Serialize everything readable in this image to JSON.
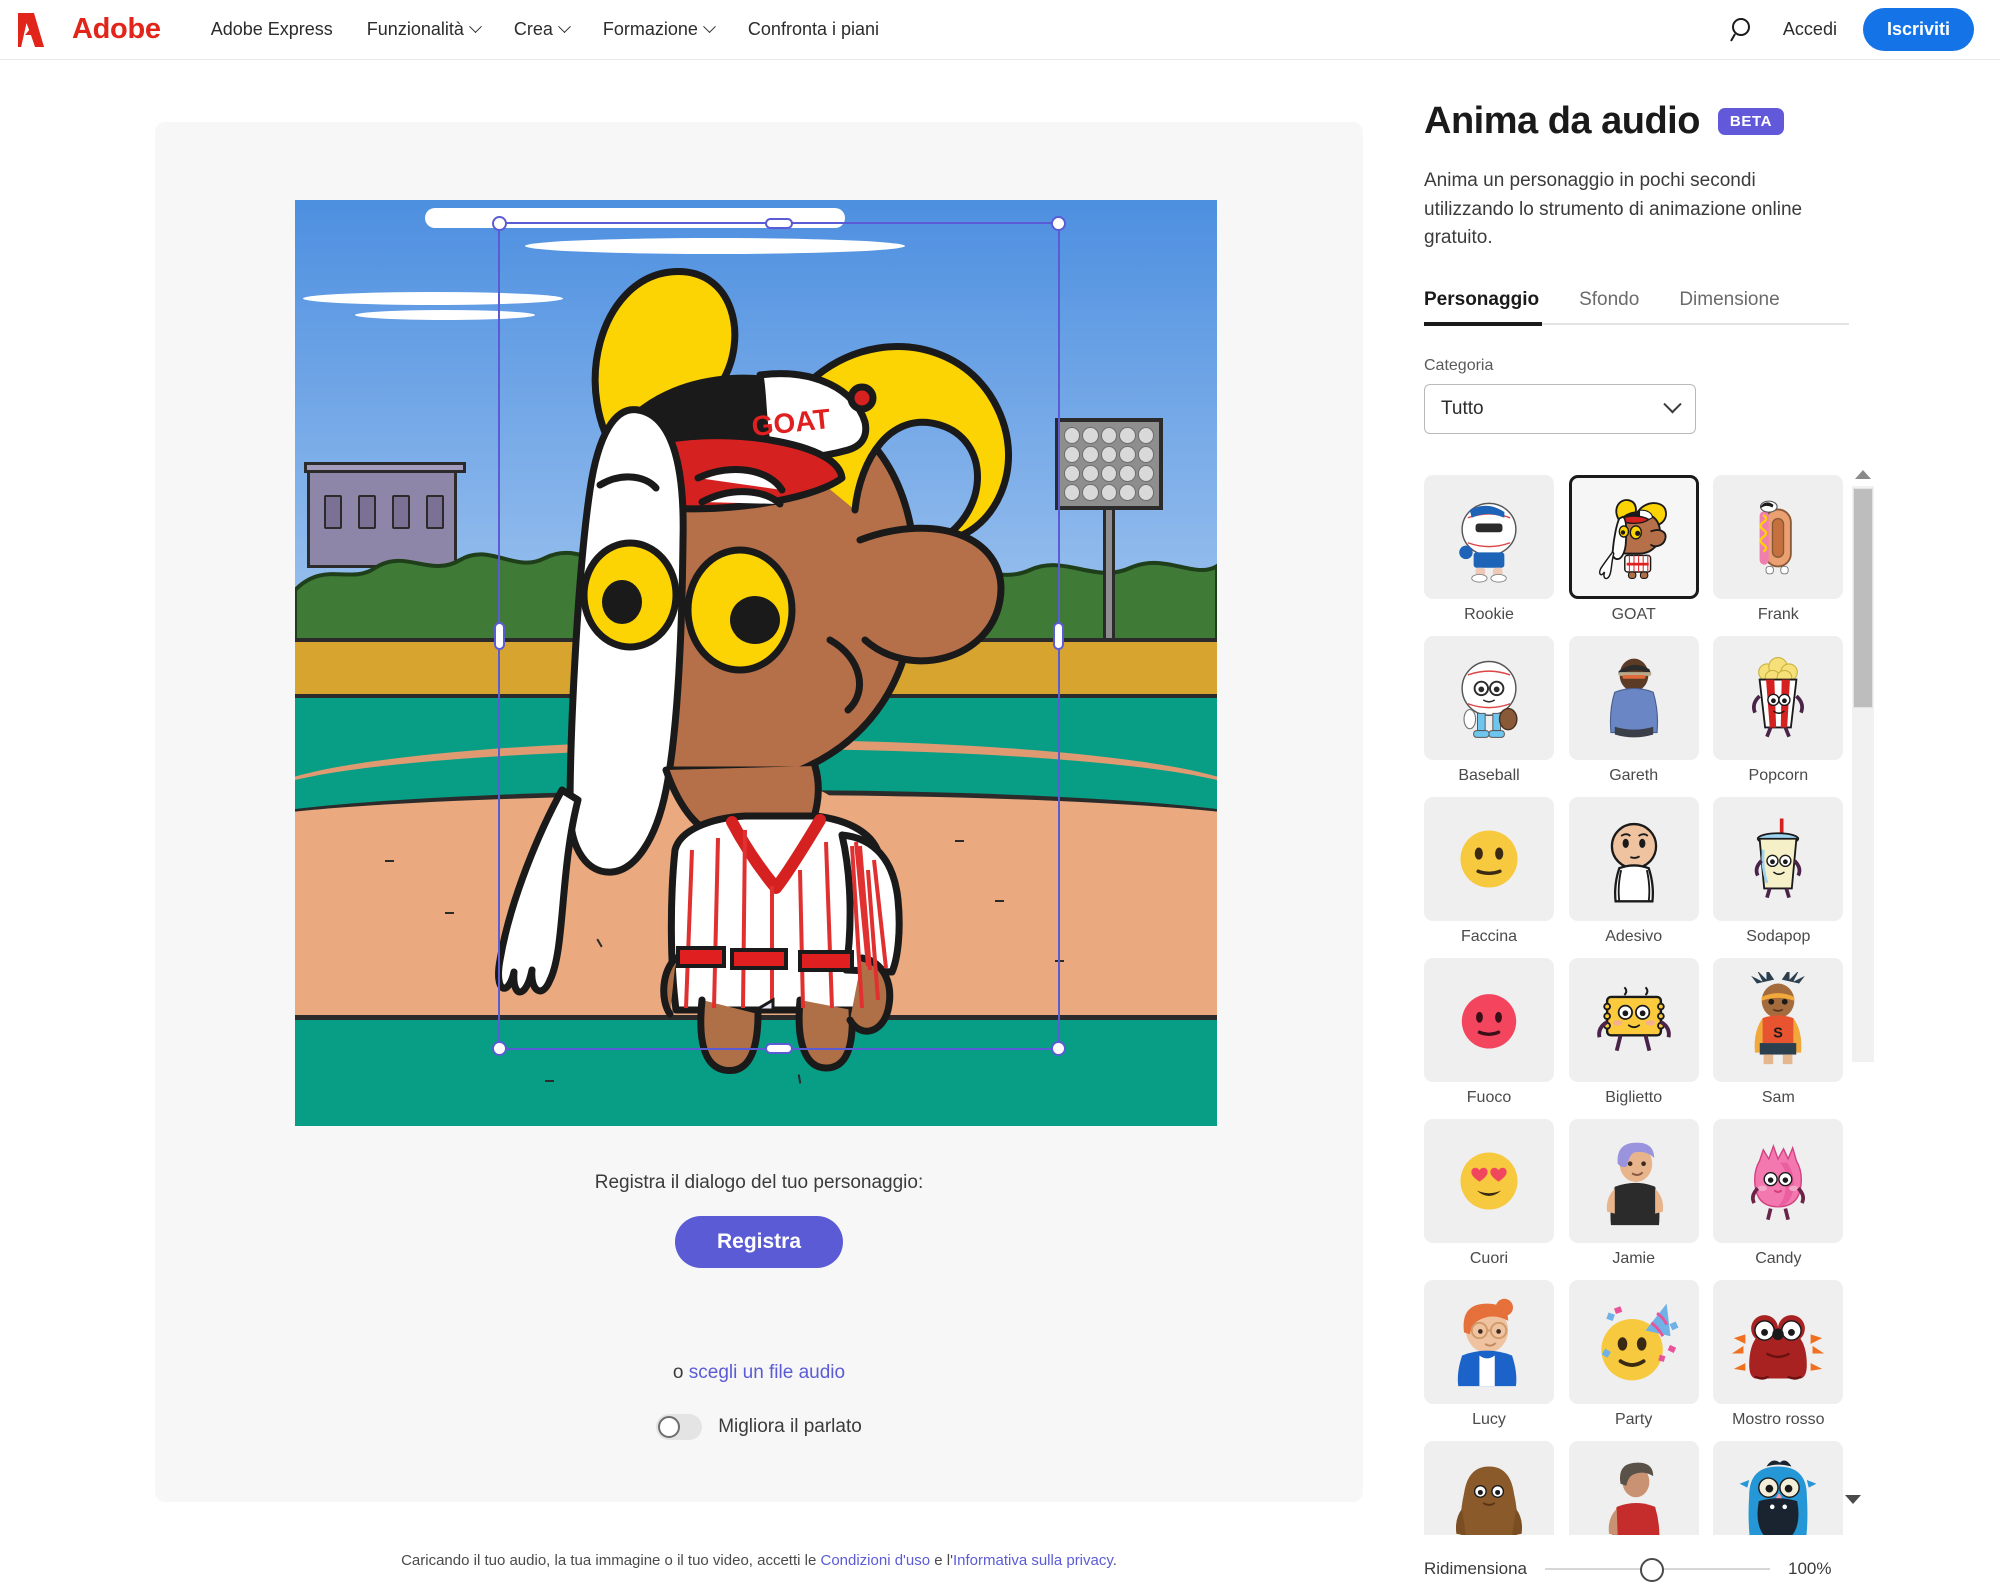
{
  "nav": {
    "brand": "Adobe",
    "links": [
      {
        "label": "Adobe Express",
        "caret": false
      },
      {
        "label": "Funzionalità",
        "caret": true
      },
      {
        "label": "Crea",
        "caret": true
      },
      {
        "label": "Formazione",
        "caret": true
      },
      {
        "label": "Confronta i piani",
        "caret": false
      }
    ],
    "search_icon": "search-icon",
    "signin": "Accedi",
    "signup": "Iscriviti",
    "signup_color": "#1473e6"
  },
  "editor": {
    "record_prompt": "Registra il dialogo del tuo personaggio:",
    "record_button": "Registra",
    "record_button_color": "#5b5bd6",
    "or_prefix": "o ",
    "choose_audio_link": "scegli un file audio",
    "enhance_toggle_label": "Migliora il parlato",
    "enhance_toggle_on": false,
    "canvas_character": "GOAT",
    "cap_text": "GOAT"
  },
  "legal": {
    "prefix": "Caricando il tuo audio, la tua immagine o il tuo video, accetti le ",
    "terms_link": "Condizioni d'uso",
    "middle": " e l'",
    "privacy_link": "Informativa sulla privacy",
    "suffix": "."
  },
  "panel": {
    "title": "Anima da audio",
    "badge": "BETA",
    "badge_color": "#6159d9",
    "description": "Anima un personaggio in pochi secondi utilizzando lo strumento di animazione online gratuito.",
    "tabs": [
      {
        "label": "Personaggio",
        "active": true
      },
      {
        "label": "Sfondo",
        "active": false
      },
      {
        "label": "Dimensione",
        "active": false
      }
    ],
    "category_label": "Categoria",
    "category_value": "Tutto",
    "characters": [
      {
        "name": "Rookie",
        "selected": false
      },
      {
        "name": "GOAT",
        "selected": true
      },
      {
        "name": "Frank",
        "selected": false
      },
      {
        "name": "Baseball",
        "selected": false
      },
      {
        "name": "Gareth",
        "selected": false
      },
      {
        "name": "Popcorn",
        "selected": false
      },
      {
        "name": "Faccina",
        "selected": false
      },
      {
        "name": "Adesivo",
        "selected": false
      },
      {
        "name": "Sodapop",
        "selected": false
      },
      {
        "name": "Fuoco",
        "selected": false
      },
      {
        "name": "Biglietto",
        "selected": false
      },
      {
        "name": "Sam",
        "selected": false
      },
      {
        "name": "Cuori",
        "selected": false
      },
      {
        "name": "Jamie",
        "selected": false
      },
      {
        "name": "Candy",
        "selected": false
      },
      {
        "name": "Lucy",
        "selected": false
      },
      {
        "name": "Party",
        "selected": false
      },
      {
        "name": "Mostro rosso",
        "selected": false
      },
      {
        "name": "",
        "selected": false
      },
      {
        "name": "",
        "selected": false
      },
      {
        "name": "",
        "selected": false
      }
    ],
    "resize_label": "Ridimensiona",
    "resize_value": "100%"
  }
}
